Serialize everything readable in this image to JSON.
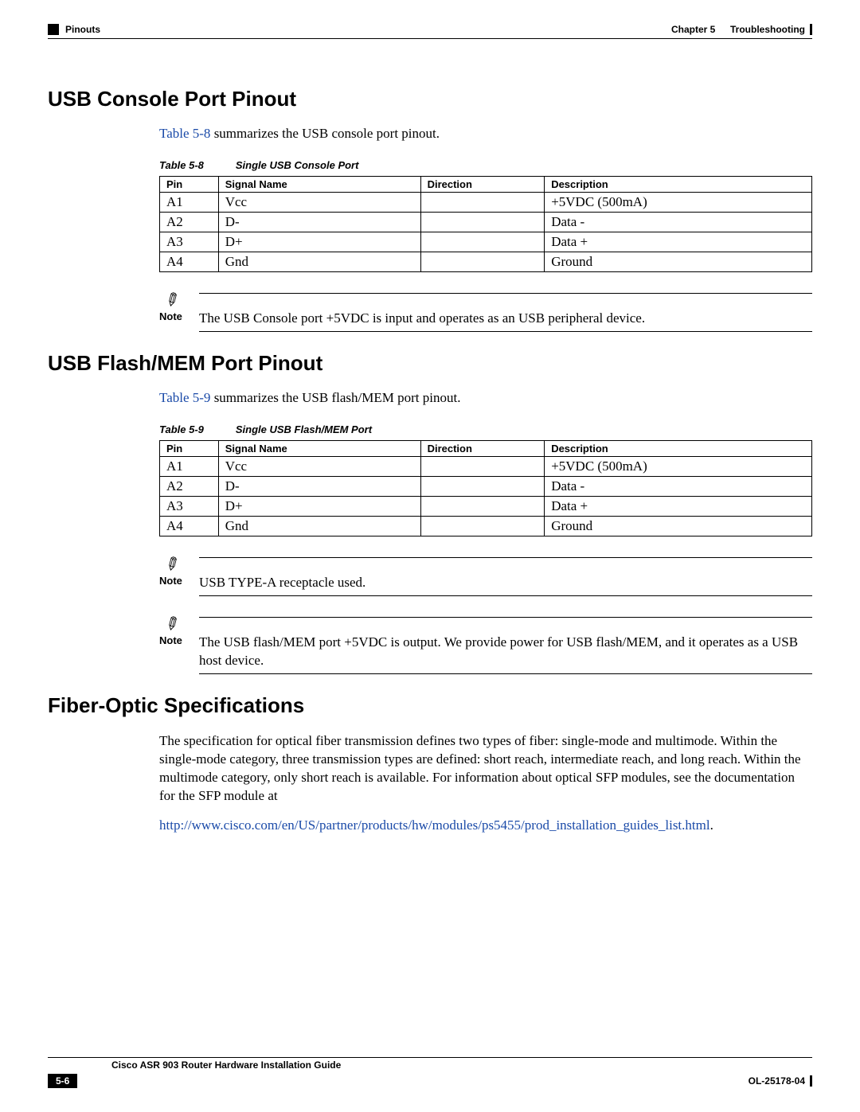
{
  "header": {
    "section_label": "Pinouts",
    "chapter_label": "Chapter 5",
    "chapter_title": "Troubleshooting"
  },
  "s1": {
    "heading": "USB Console Port Pinout",
    "intro_link": "Table 5-8",
    "intro_rest": " summarizes the USB console port pinout.",
    "caption_prefix": "Table 5-8",
    "caption_title": "Single USB Console Port",
    "headers": {
      "pin": "Pin",
      "signal": "Signal Name",
      "dir": "Direction",
      "desc": "Description"
    },
    "rows": [
      {
        "pin": "A1",
        "signal": "Vcc",
        "dir": "",
        "desc": "+5VDC (500mA)"
      },
      {
        "pin": "A2",
        "signal": "D-",
        "dir": "",
        "desc": "Data -"
      },
      {
        "pin": "A3",
        "signal": "D+",
        "dir": "",
        "desc": "Data +"
      },
      {
        "pin": "A4",
        "signal": "Gnd",
        "dir": "",
        "desc": "Ground"
      }
    ],
    "note_label": "Note",
    "note_text": "The USB Console port +5VDC is input and operates as an USB peripheral device."
  },
  "s2": {
    "heading": "USB Flash/MEM Port Pinout",
    "intro_link": "Table 5-9",
    "intro_rest": " summarizes the USB flash/MEM port pinout.",
    "caption_prefix": "Table 5-9",
    "caption_title": "Single USB Flash/MEM Port",
    "headers": {
      "pin": "Pin",
      "signal": "Signal Name",
      "dir": "Direction",
      "desc": "Description"
    },
    "rows": [
      {
        "pin": "A1",
        "signal": "Vcc",
        "dir": "",
        "desc": "+5VDC (500mA)"
      },
      {
        "pin": "A2",
        "signal": "D-",
        "dir": "",
        "desc": "Data -"
      },
      {
        "pin": "A3",
        "signal": "D+",
        "dir": "",
        "desc": "Data +"
      },
      {
        "pin": "A4",
        "signal": "Gnd",
        "dir": "",
        "desc": "Ground"
      }
    ],
    "note1_label": "Note",
    "note1_text": "USB TYPE-A receptacle used.",
    "note2_label": "Note",
    "note2_text": "The USB flash/MEM port +5VDC is output. We provide power for USB flash/MEM, and it operates as a USB host device."
  },
  "s3": {
    "heading": "Fiber-Optic Specifications",
    "para": "The specification for optical fiber transmission defines two types of fiber: single-mode and multimode. Within the single-mode category, three transmission types are defined: short reach, intermediate reach, and long reach. Within the multimode category, only short reach is available. For information about optical SFP modules, see the documentation for the SFP module at",
    "url": "http://www.cisco.com/en/US/partner/products/hw/modules/ps5455/prod_installation_guides_list.html"
  },
  "footer": {
    "guide": "Cisco ASR 903 Router Hardware Installation Guide",
    "page": "5-6",
    "doc_id": "OL-25178-04"
  }
}
